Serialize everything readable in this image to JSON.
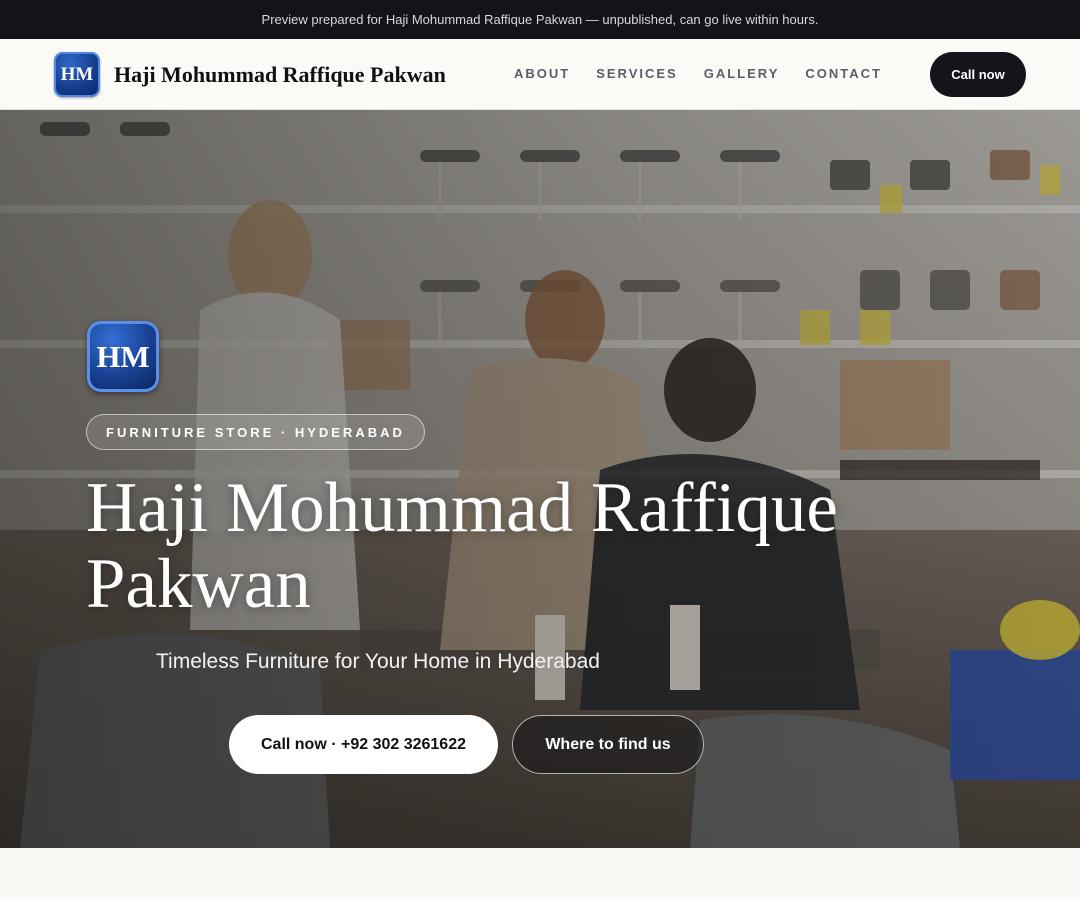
{
  "topbar": {
    "notice": "Preview prepared for Haji Mohummad Raffique Pakwan — unpublished, can go live within hours."
  },
  "header": {
    "badge_initials": "HM",
    "brand_name": "Haji Mohummad Raffique Pakwan",
    "nav": [
      "ABOUT",
      "SERVICES",
      "GALLERY",
      "CONTACT"
    ],
    "cta_label": "Call now"
  },
  "hero": {
    "badge_initials": "HM",
    "eyebrow": "FURNITURE STORE · HYDERABAD",
    "title": "Haji Mohummad Raffique Pakwan",
    "subtitle": "Timeless Furniture for Your Home in Hyderabad",
    "primary_cta": "Call now · +92 302 3261622",
    "secondary_cta": "Where to find us",
    "photo_icon": "furniture-showroom-photo"
  },
  "colors": {
    "topbar_bg": "#12141a",
    "badge_blue": "#183f90",
    "cta_dark": "#14151a",
    "page_bg": "#faf9f6"
  }
}
